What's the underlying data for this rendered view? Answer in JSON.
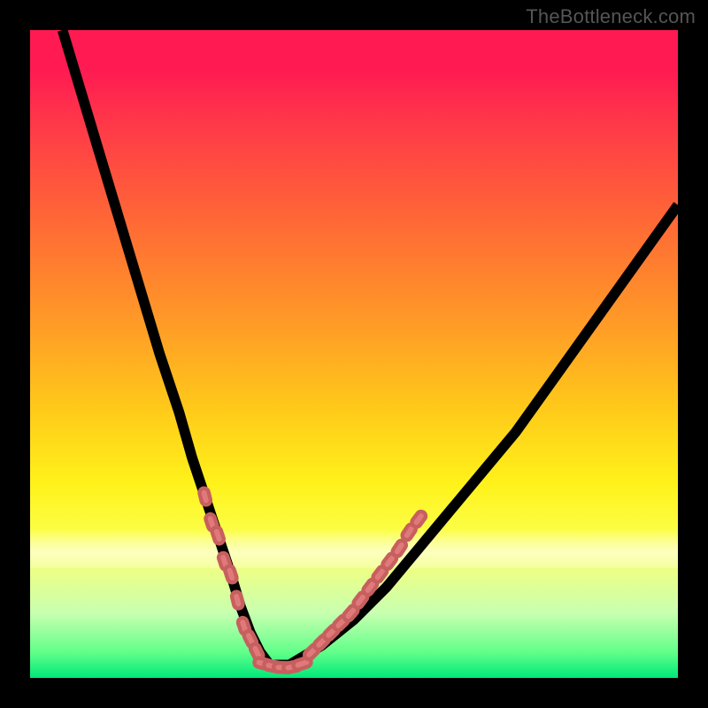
{
  "watermark": "TheBottleneck.com",
  "colors": {
    "frame": "#000000",
    "gradient_top": "#ff1a52",
    "gradient_mid": "#ffd21a",
    "gradient_bottom": "#00e87a",
    "curve": "#000000",
    "marker": "#e07a7a"
  },
  "chart_data": {
    "type": "line",
    "title": "",
    "xlabel": "",
    "ylabel": "",
    "xlim": [
      0,
      100
    ],
    "ylim": [
      0,
      100
    ],
    "grid": false,
    "series": [
      {
        "name": "curve",
        "x": [
          5,
          8,
          11,
          14,
          17,
          20,
          23,
          25,
          27,
          29,
          31,
          32.5,
          34,
          35.5,
          37,
          40,
          45,
          50,
          55,
          60,
          65,
          70,
          75,
          80,
          85,
          90,
          95,
          100
        ],
        "y": [
          100,
          90,
          80,
          70,
          60,
          50,
          41,
          34,
          28,
          22,
          16,
          11,
          7,
          4,
          2,
          2,
          5,
          9,
          14,
          20,
          26,
          32,
          38,
          45,
          52,
          59,
          66,
          73
        ]
      }
    ],
    "markers": {
      "left_limb": [
        {
          "x": 27.0,
          "y": 28
        },
        {
          "x": 28.0,
          "y": 24
        },
        {
          "x": 29.0,
          "y": 22
        },
        {
          "x": 30.0,
          "y": 18
        },
        {
          "x": 31.0,
          "y": 16
        },
        {
          "x": 32.0,
          "y": 12
        },
        {
          "x": 33.0,
          "y": 8
        },
        {
          "x": 34.0,
          "y": 6
        },
        {
          "x": 35.0,
          "y": 4
        }
      ],
      "bottom": [
        {
          "x": 36.0,
          "y": 2.2
        },
        {
          "x": 37.5,
          "y": 1.8
        },
        {
          "x": 39.0,
          "y": 1.6
        },
        {
          "x": 40.5,
          "y": 1.7
        },
        {
          "x": 42.0,
          "y": 2.2
        }
      ],
      "right_limb": [
        {
          "x": 43.5,
          "y": 4
        },
        {
          "x": 45.0,
          "y": 5.5
        },
        {
          "x": 46.5,
          "y": 7
        },
        {
          "x": 48.0,
          "y": 8.5
        },
        {
          "x": 49.5,
          "y": 10
        },
        {
          "x": 51.0,
          "y": 12
        },
        {
          "x": 52.5,
          "y": 14
        },
        {
          "x": 54.0,
          "y": 16
        },
        {
          "x": 55.5,
          "y": 18
        },
        {
          "x": 57.0,
          "y": 20
        },
        {
          "x": 58.5,
          "y": 22.5
        },
        {
          "x": 60.0,
          "y": 24.5
        }
      ]
    }
  }
}
